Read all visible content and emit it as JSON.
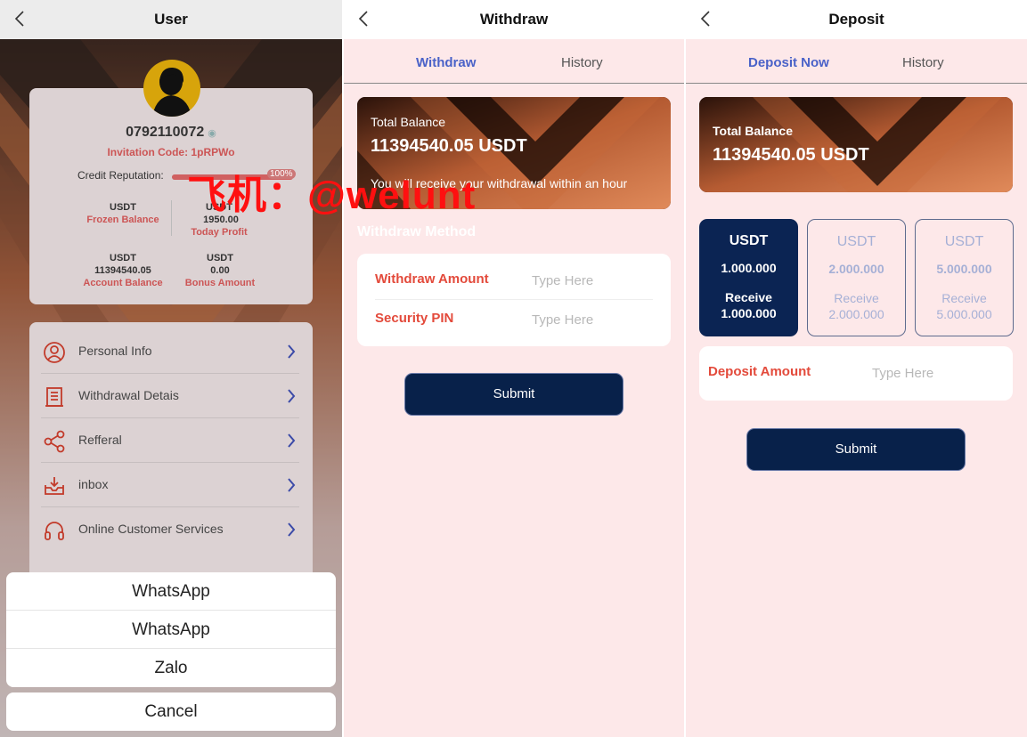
{
  "user_panel": {
    "title": "User",
    "phone": "0792110072",
    "invitation_code": "Invitation Code:  1pRPWo",
    "credit_label": "Credit Reputation:",
    "credit_percent": "100%",
    "credit_value": 1.0,
    "stats": {
      "frozen": {
        "currency": "USDT",
        "label": "Frozen Balance"
      },
      "today": {
        "currency": "USDT",
        "value": "1950.00",
        "label": "Today Profit"
      },
      "account": {
        "currency": "USDT",
        "value": "11394540.05",
        "label": "Account Balance"
      },
      "bonus": {
        "currency": "USDT",
        "value": "0.00",
        "label": "Bonus Amount"
      }
    },
    "menu": [
      {
        "label": "Personal Info",
        "icon": "user-circle-icon"
      },
      {
        "label": "Withdrawal Detais",
        "icon": "document-list-icon"
      },
      {
        "label": "Refferal",
        "icon": "share-icon"
      },
      {
        "label": "inbox",
        "icon": "inbox-icon"
      },
      {
        "label": "Online Customer Services",
        "icon": "headset-icon"
      }
    ],
    "action_sheet": [
      "WhatsApp",
      "WhatsApp",
      "Zalo"
    ],
    "cancel_label": "Cancel",
    "watermark": "飞机：@welunt"
  },
  "withdraw_panel": {
    "title": "Withdraw",
    "tabs": {
      "active": "Withdraw",
      "other": "History"
    },
    "balance_label": "Total Balance",
    "balance": "11394540.05 USDT",
    "note": "You will receive your withdrawal within an hour",
    "method_label": "Withdraw Method",
    "amount_label": "Withdraw Amount",
    "pin_label": "Security PIN",
    "placeholder": "Type Here",
    "submit": "Submit"
  },
  "deposit_panel": {
    "title": "Deposit",
    "tabs": {
      "active": "Deposit Now",
      "other": "History"
    },
    "balance_label": "Total Balance",
    "balance": "11394540.05 USDT",
    "packages": [
      {
        "currency": "USDT",
        "value": "1.000.000",
        "receive_label": "Receive",
        "receive": "1.000.000",
        "selected": true
      },
      {
        "currency": "USDT",
        "value": "2.000.000",
        "receive_label": "Receive",
        "receive": "2.000.000",
        "selected": false
      },
      {
        "currency": "USDT",
        "value": "5.000.000",
        "receive_label": "Receive",
        "receive": "5.000.000",
        "selected": false
      }
    ],
    "amount_label": "Deposit Amount",
    "placeholder": "Type Here",
    "submit": "Submit"
  },
  "colors": {
    "accent_red": "#e34a3b",
    "navy": "#08214a",
    "tab_blue": "#4a62c8",
    "pink_bg": "#fde8e9",
    "watermark_red": "#ff1010"
  }
}
